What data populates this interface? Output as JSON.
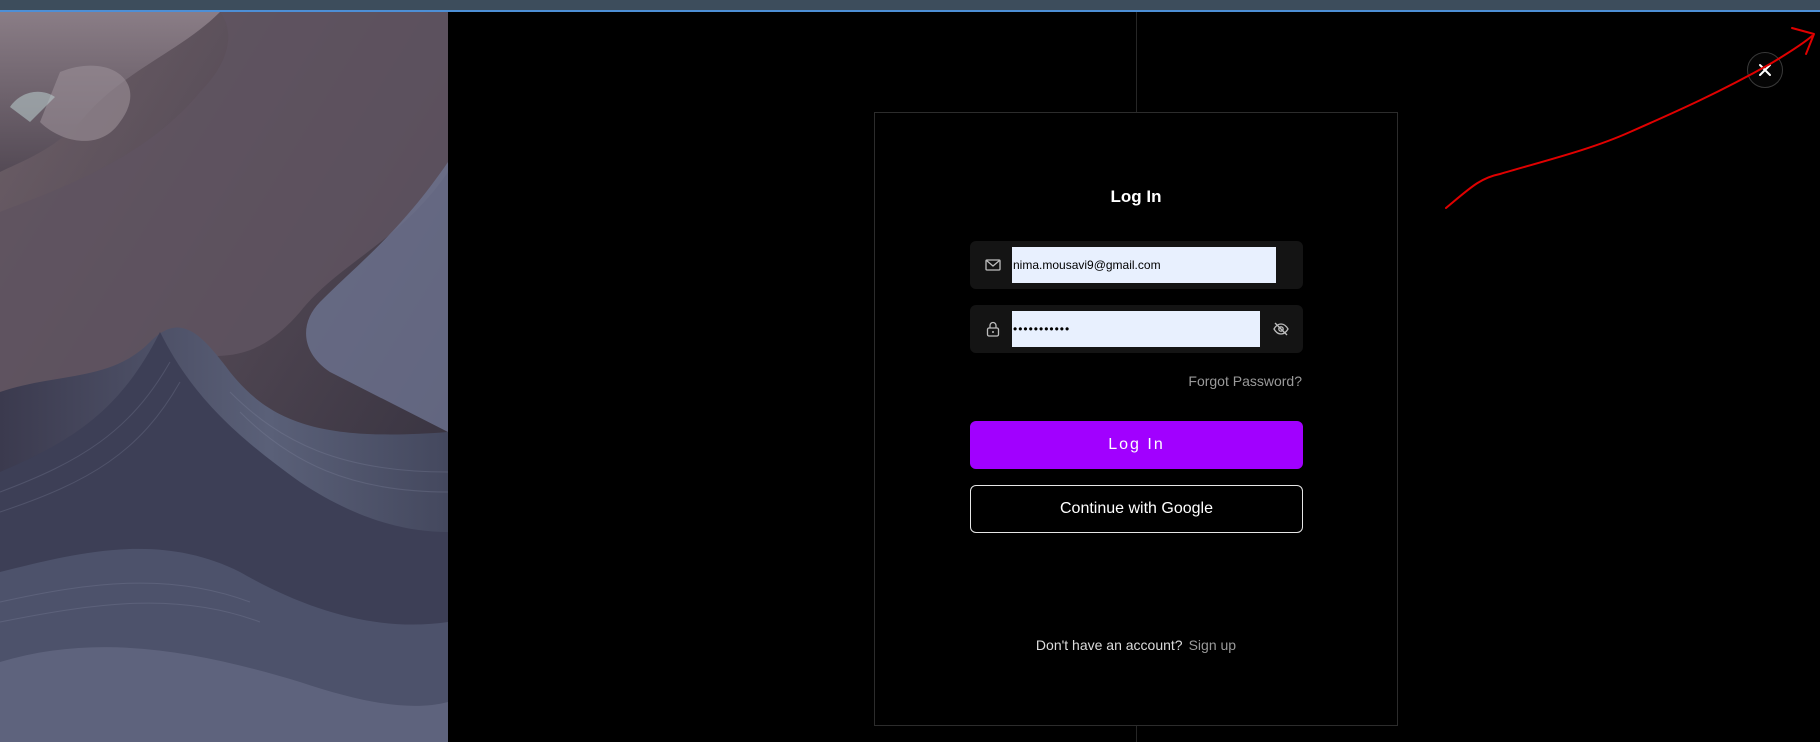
{
  "login": {
    "title": "Log In",
    "email_value": "nima.mousavi9@gmail.com",
    "password_value": "•••••••••••",
    "forgot_label": "Forgot Password?",
    "submit_label": "Log In",
    "google_label": "Continue with Google",
    "signup_prompt": "Don't have an account?",
    "signup_label": "Sign up"
  },
  "icons": {
    "email": "mail-icon",
    "password": "lock-icon",
    "toggle": "eye-off-icon",
    "close": "close-icon"
  },
  "colors": {
    "accent": "#a100ff",
    "background": "#000000",
    "input_fill": "#e8f0fe",
    "annotation": "#e00000"
  }
}
